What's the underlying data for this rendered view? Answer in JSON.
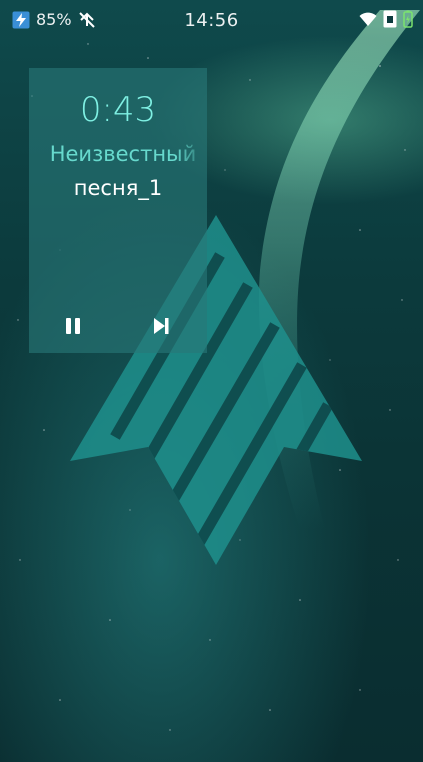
{
  "status_bar": {
    "battery_percent": "85%",
    "clock": "14:56",
    "charging": true
  },
  "media_player": {
    "elapsed": "0:43",
    "artist": "Неизвестный",
    "track": "песня_1",
    "controls": {
      "play_pause_icon": "pause-icon",
      "next_icon": "skip-next-icon"
    }
  },
  "colors": {
    "accent": "#7ff0e3",
    "background": "#0c3b3d",
    "logo": "#1f8f8c"
  }
}
